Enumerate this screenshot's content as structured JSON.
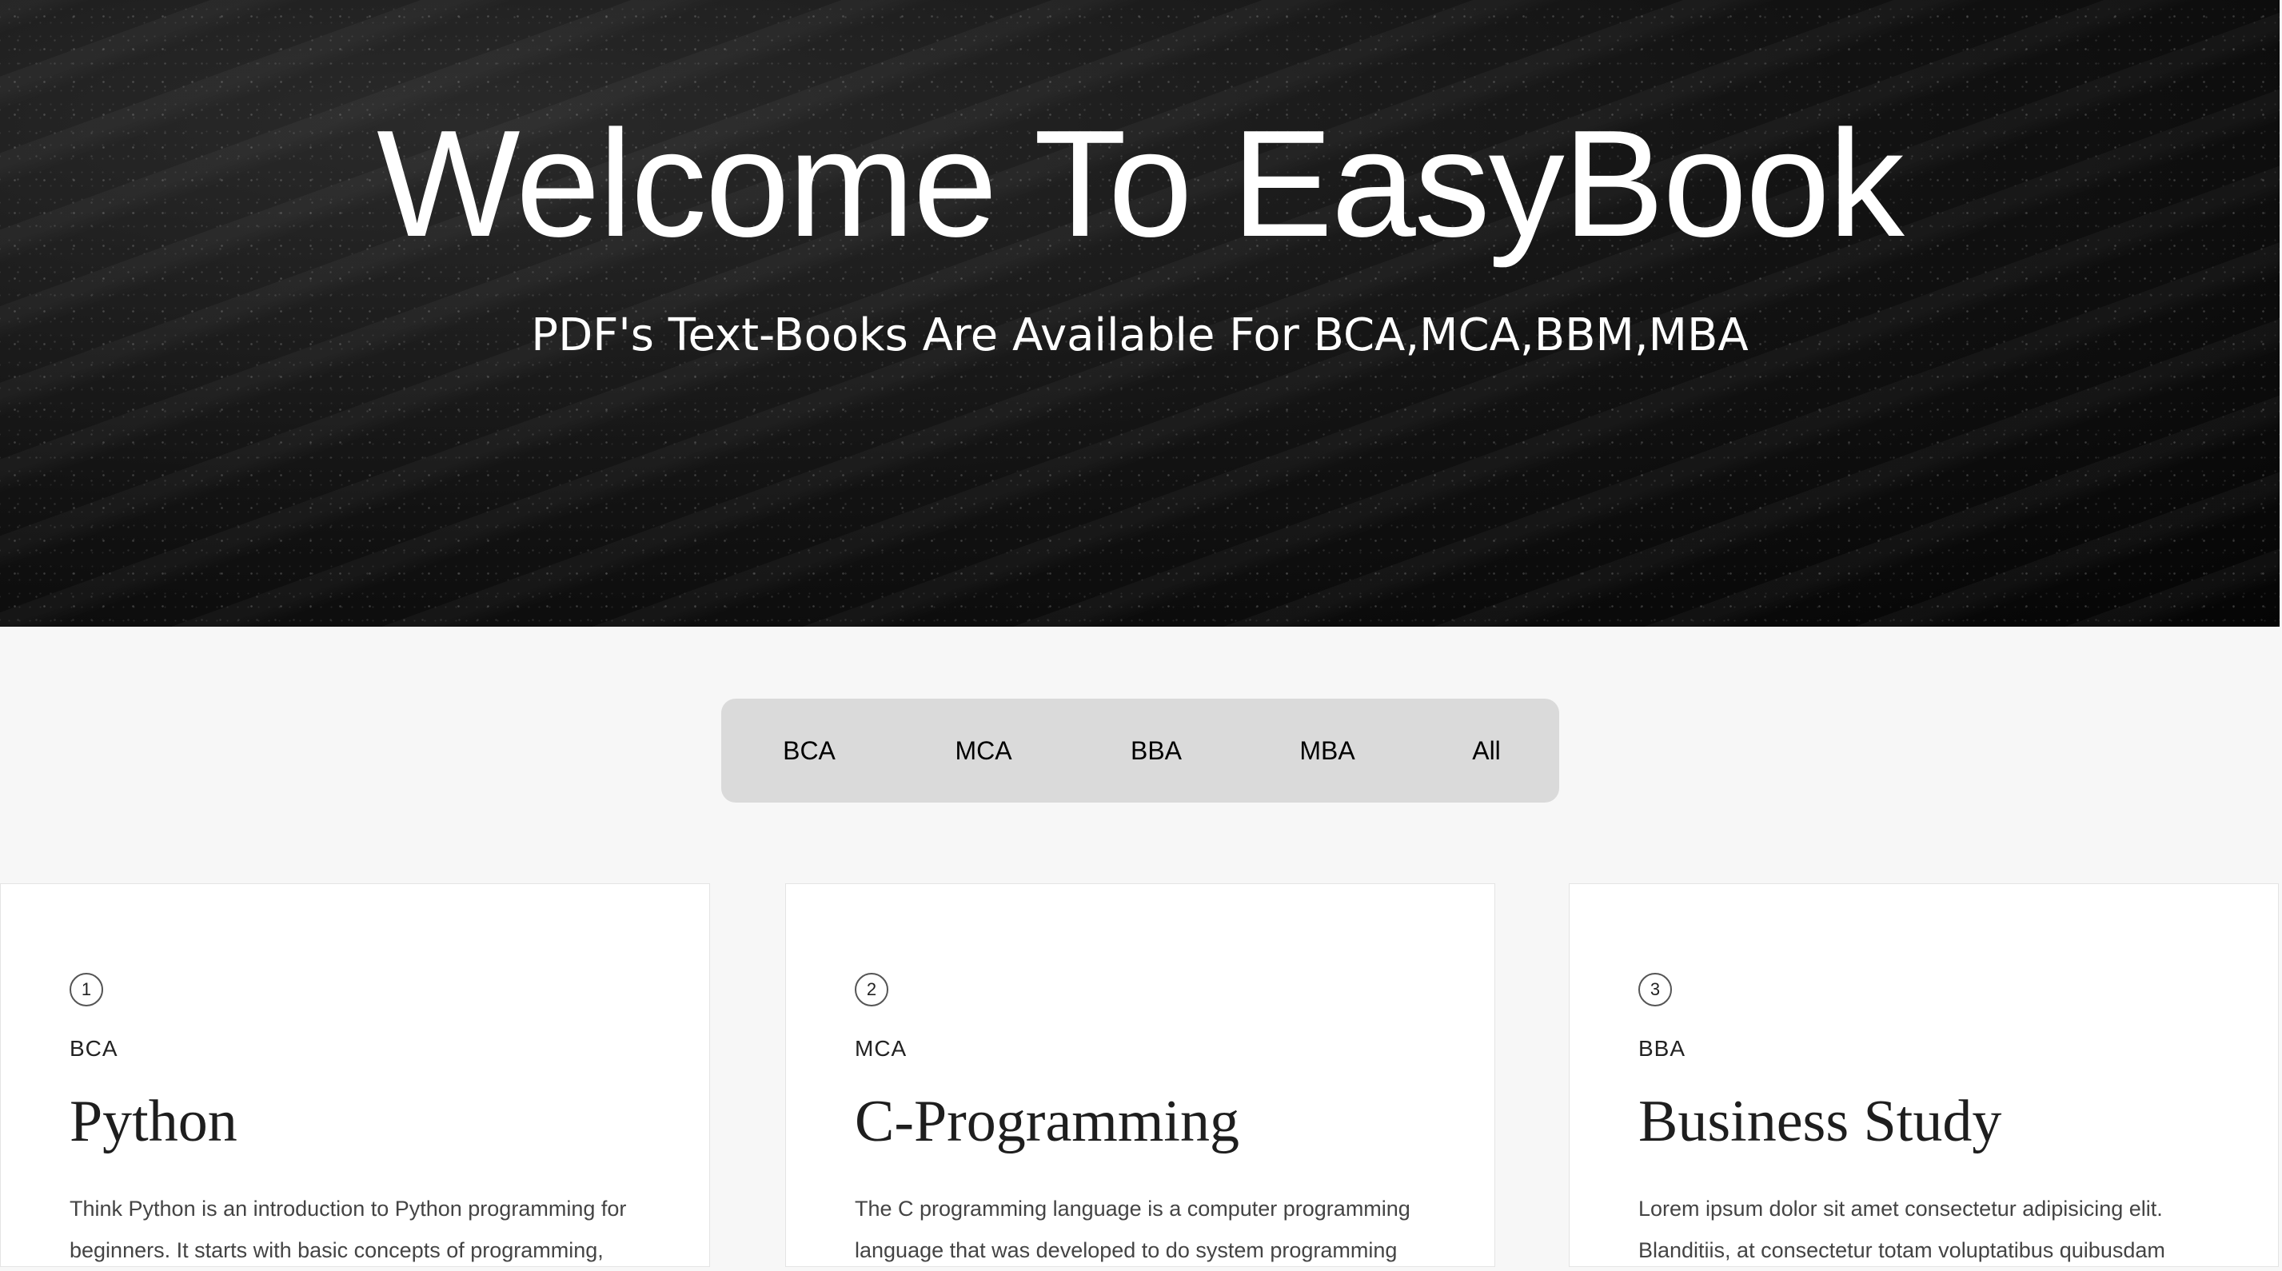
{
  "hero": {
    "title": "Welcome To EasyBook",
    "subtitle": "PDF's Text-Books Are Available For BCA,MCA,BBM,MBA"
  },
  "filters": [
    "BCA",
    "MCA",
    "BBA",
    "MBA",
    "All"
  ],
  "cards": [
    {
      "number": "1",
      "category": "BCA",
      "title": "Python",
      "description": "Think Python is an introduction to Python programming for beginners. It starts with basic concepts of programming,"
    },
    {
      "number": "2",
      "category": "MCA",
      "title": "C-Programming",
      "description": "The C programming language is a computer programming language that was developed to do system programming"
    },
    {
      "number": "3",
      "category": "BBA",
      "title": "Business Study",
      "description": "Lorem ipsum dolor sit amet consectetur adipisicing elit. Blanditiis, at consectetur totam voluptatibus quibusdam"
    }
  ]
}
